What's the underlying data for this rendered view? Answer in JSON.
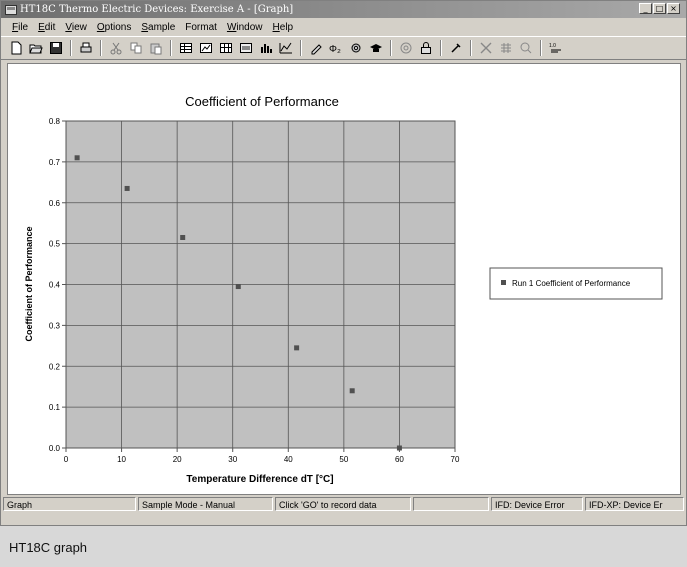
{
  "window": {
    "title": "HT18C Thermo Electric Devices: Exercise A - [Graph]",
    "controls": {
      "minimize": "_",
      "restore": "□",
      "close": "×"
    }
  },
  "menubar": {
    "items": [
      {
        "label": "File",
        "mnemonic": "F",
        "rest": "ile"
      },
      {
        "label": "Edit",
        "mnemonic": "E",
        "rest": "dit"
      },
      {
        "label": "View",
        "mnemonic": "V",
        "rest": "iew"
      },
      {
        "label": "Options",
        "mnemonic": "O",
        "rest": "ptions"
      },
      {
        "label": "Sample",
        "mnemonic": "S",
        "rest": "ample"
      },
      {
        "label": "Format",
        "mnemonic": "",
        "rest": "Format"
      },
      {
        "label": "Window",
        "mnemonic": "W",
        "rest": "indow"
      },
      {
        "label": "Help",
        "mnemonic": "H",
        "rest": "elp"
      }
    ]
  },
  "toolbar": {
    "icons": [
      "new-file-icon",
      "open-folder-icon",
      "save-icon",
      "|",
      "print-icon",
      "|",
      "cut-icon",
      "copy-icon",
      "paste-icon",
      "|",
      "table-view-icon",
      "graph-view-icon",
      "grid-view-icon",
      "results-icon",
      "bar-chart-icon",
      "line-chart-icon",
      "|",
      "pencil-icon",
      "phi-icon",
      "settings-icon",
      "cap-icon",
      "|",
      "zoom-icon",
      "lock-icon",
      "|",
      "probe-icon",
      "|",
      "x-icon",
      "calculator-icon",
      "search-icon",
      "|",
      "version-icon"
    ]
  },
  "chart_data": {
    "type": "scatter",
    "title": "Coefficient of Performance",
    "xlabel": "Temperature Difference dT [°C]",
    "ylabel": "Coefficient of Performance",
    "xlim": [
      0,
      70
    ],
    "ylim": [
      0.0,
      0.8
    ],
    "xticks": [
      "0",
      "10",
      "20",
      "30",
      "40",
      "50",
      "60",
      "70"
    ],
    "yticks": [
      "0.0",
      "0.1",
      "0.2",
      "0.3",
      "0.4",
      "0.5",
      "0.6",
      "0.7",
      "0.8"
    ],
    "grid": true,
    "legend_position": "right",
    "series": [
      {
        "name": "Run 1 Coefficient of Performance",
        "color": "#505050",
        "x": [
          2,
          11,
          21,
          31,
          41.5,
          51.5,
          60
        ],
        "y": [
          0.71,
          0.635,
          0.515,
          0.395,
          0.245,
          0.14,
          0.0
        ]
      }
    ],
    "plot_background": "#c0c0c0"
  },
  "statusbar": {
    "panels": [
      {
        "name": "status-view",
        "text": "Graph"
      },
      {
        "name": "status-sample-mode",
        "text": "Sample Mode - Manual"
      },
      {
        "name": "status-hint",
        "text": "Click 'GO' to record data"
      },
      {
        "name": "status-blank",
        "text": ""
      },
      {
        "name": "status-ifd",
        "text": "IFD: Device Error"
      },
      {
        "name": "status-ifd-xp",
        "text": "IFD-XP: Device Er"
      }
    ]
  },
  "caption": "HT18C graph"
}
